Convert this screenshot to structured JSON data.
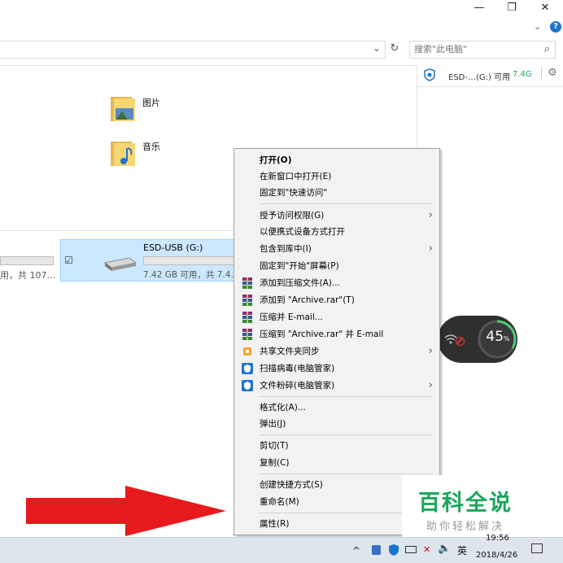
{
  "window": {
    "minimize": "—",
    "restore": "❐",
    "close": "✕",
    "help": "?"
  },
  "address": {
    "dropdown": "⌄",
    "refresh": "↻"
  },
  "search": {
    "placeholder": "搜索\"此电脑\"",
    "icon": "⌕"
  },
  "right_pane": {
    "drive_text": "ESD-…(G:) 可用",
    "free": "7.4G"
  },
  "folders": [
    {
      "name": "图片"
    },
    {
      "name": "音乐"
    }
  ],
  "drives": {
    "left_partial": "用，共 107…",
    "selected": {
      "name": "ESD-USB (G:)",
      "free_text": "7.42 GB 可用，共 7.4…",
      "checked": "☑"
    }
  },
  "context_menu": {
    "items": [
      {
        "label": "打开(O)",
        "bold": true
      },
      {
        "label": "在新窗口中打开(E)"
      },
      {
        "label": "固定到\"快速访问\""
      },
      {
        "label": "授予访问权限(G)",
        "sub": true
      },
      {
        "label": "以便携式设备方式打开"
      },
      {
        "label": "包含到库中(I)",
        "sub": true
      },
      {
        "label": "固定到\"开始\"屏幕(P)"
      },
      {
        "label": "添加到压缩文件(A)...",
        "icon": "winrar"
      },
      {
        "label": "添加到 \"Archive.rar\"(T)",
        "icon": "winrar"
      },
      {
        "label": "压缩并 E-mail...",
        "icon": "winrar"
      },
      {
        "label": "压缩到 \"Archive.rar\" 并 E-mail",
        "icon": "winrar"
      },
      {
        "label": "共享文件夹同步",
        "icon": "sync",
        "sub": true
      },
      {
        "label": "扫描病毒(电脑管家)",
        "icon": "shield"
      },
      {
        "label": "文件粉碎(电脑管家)",
        "icon": "shield",
        "sub": true
      },
      {
        "label": "格式化(A)..."
      },
      {
        "label": "弹出(J)"
      },
      {
        "label": "剪切(T)"
      },
      {
        "label": "复制(C)"
      },
      {
        "label": "创建快捷方式(S)"
      },
      {
        "label": "重命名(M)"
      },
      {
        "label": "属性(R)"
      }
    ]
  },
  "network_widget": {
    "percent": "45",
    "unit": "%"
  },
  "watermark": {
    "title": "百科全说",
    "subtitle": "助你轻松解决"
  },
  "taskbar": {
    "chevron": "^",
    "ime": "英",
    "time": "19:56",
    "date": "2018/4/26"
  },
  "colors": {
    "arrow": "#e8191c",
    "selection": "#cce8ff",
    "accent": "#0078d7",
    "watermark": "#1aa75b",
    "watermark_sub": "#999999"
  }
}
